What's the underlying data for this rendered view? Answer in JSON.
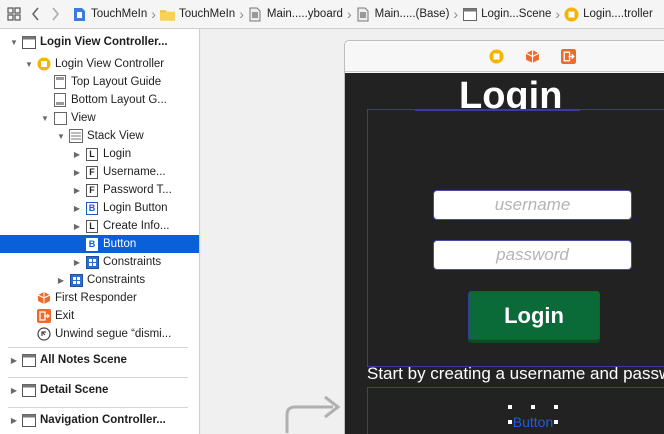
{
  "jumpbar": {
    "crumbs": [
      {
        "label": "TouchMeIn",
        "icon": "project-file-icon"
      },
      {
        "label": "TouchMeIn",
        "icon": "folder-icon"
      },
      {
        "label": "Main.....yboard",
        "icon": "storyboard-icon"
      },
      {
        "label": "Main.....(Base)",
        "icon": "storyboard-icon"
      },
      {
        "label": "Login...Scene",
        "icon": "scene-icon"
      },
      {
        "label": "Login....troller",
        "icon": "view-controller-icon"
      }
    ]
  },
  "outline": {
    "items": [
      {
        "label": "Login View Controller...",
        "icon": "scene-icon",
        "bold": true,
        "disclosure": "open"
      },
      {
        "label": "Login View Controller",
        "icon": "view-controller-icon",
        "bold": false,
        "disclosure": "open"
      },
      {
        "label": "Top Layout Guide",
        "icon": "layout-guide-icon",
        "bold": false,
        "disclosure": ""
      },
      {
        "label": "Bottom Layout G...",
        "icon": "layout-guide-icon",
        "bold": false,
        "disclosure": ""
      },
      {
        "label": "View",
        "icon": "view-icon",
        "bold": false,
        "disclosure": "open"
      },
      {
        "label": "Stack View",
        "icon": "stack-view-icon",
        "bold": false,
        "disclosure": "open"
      },
      {
        "label": "Login",
        "icon": "label-icon",
        "glyph": "L",
        "bold": false,
        "disclosure": "closed"
      },
      {
        "label": "Username...",
        "icon": "text-field-icon",
        "glyph": "F",
        "bold": false,
        "disclosure": "closed"
      },
      {
        "label": "Password T...",
        "icon": "text-field-icon",
        "glyph": "F",
        "bold": false,
        "disclosure": "closed"
      },
      {
        "label": "Login Button",
        "icon": "button-icon",
        "glyph": "B",
        "bold": false,
        "disclosure": "closed"
      },
      {
        "label": "Create Info...",
        "icon": "label-icon",
        "glyph": "L",
        "bold": false,
        "disclosure": "closed"
      },
      {
        "label": "Button",
        "icon": "button-icon",
        "glyph": "B",
        "bold": false,
        "disclosure": "",
        "selected": true
      },
      {
        "label": "Constraints",
        "icon": "constraints-icon",
        "bold": false,
        "disclosure": "closed"
      },
      {
        "label": "Constraints",
        "icon": "constraints-icon",
        "bold": false,
        "disclosure": "closed"
      },
      {
        "label": "First Responder",
        "icon": "first-responder-icon",
        "bold": false,
        "disclosure": ""
      },
      {
        "label": "Exit",
        "icon": "exit-icon",
        "bold": false,
        "disclosure": ""
      },
      {
        "label": "Unwind segue “dismi...",
        "icon": "unwind-segue-icon",
        "bold": false,
        "disclosure": ""
      }
    ],
    "scenes": [
      {
        "label": "All Notes Scene",
        "icon": "scene-icon"
      },
      {
        "label": "Detail Scene",
        "icon": "scene-icon"
      },
      {
        "label": "Navigation Controller...",
        "icon": "scene-icon"
      }
    ]
  },
  "canvas": {
    "login_title": "Login",
    "username_placeholder": "username",
    "password_placeholder": "password",
    "login_button": "Login",
    "info_text": "Start by creating a username and passw",
    "small_button": "Button"
  },
  "colors": {
    "selection": "#0a60d8",
    "login_button_bg": "#0b6b38",
    "screen_bg": "#222222",
    "button_text": "#1b5fd6"
  }
}
